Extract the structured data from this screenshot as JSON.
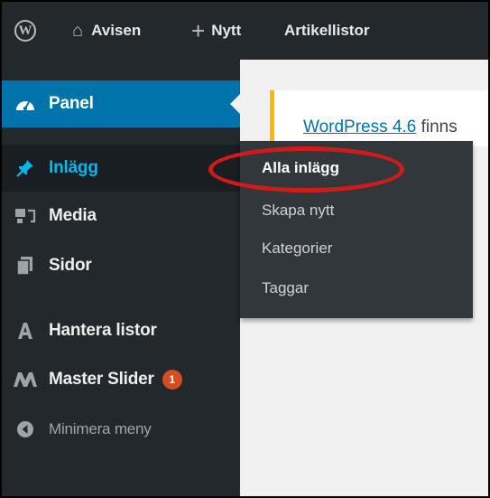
{
  "admin_bar": {
    "wp_logo_icon": "wordpress-logo-icon",
    "site_icon": "home-icon",
    "site_name": "Avisen",
    "new_icon": "plus-icon",
    "new_label": "Nytt",
    "articlelists_label": "Artikellistor"
  },
  "sidebar": {
    "items": [
      {
        "label": "Panel",
        "icon": "dashboard-gauge-icon"
      },
      {
        "label": "Inlägg",
        "icon": "pin-icon"
      },
      {
        "label": "Media",
        "icon": "media-icon"
      },
      {
        "label": "Sidor",
        "icon": "pages-icon"
      },
      {
        "label": "Hantera listor",
        "icon": "letter-a-icon"
      },
      {
        "label": "Master Slider",
        "icon": "master-slider-icon",
        "badge": "1"
      },
      {
        "label": "Minimera meny",
        "icon": "collapse-arrow-icon"
      }
    ]
  },
  "notice": {
    "link_text": "WordPress 4.6",
    "text_after": " finns"
  },
  "submenu": {
    "items": [
      "Alla inlägg",
      "Skapa nytt",
      "Kategorier",
      "Taggar"
    ]
  },
  "colors": {
    "admin_dark": "#23282d",
    "active_blue": "#0073aa",
    "highlight_text": "#00b9eb",
    "submenu_bg": "#32373c",
    "annotation_red": "#d11a1a",
    "badge_orange": "#d54e21",
    "notice_border": "#ffb900"
  }
}
